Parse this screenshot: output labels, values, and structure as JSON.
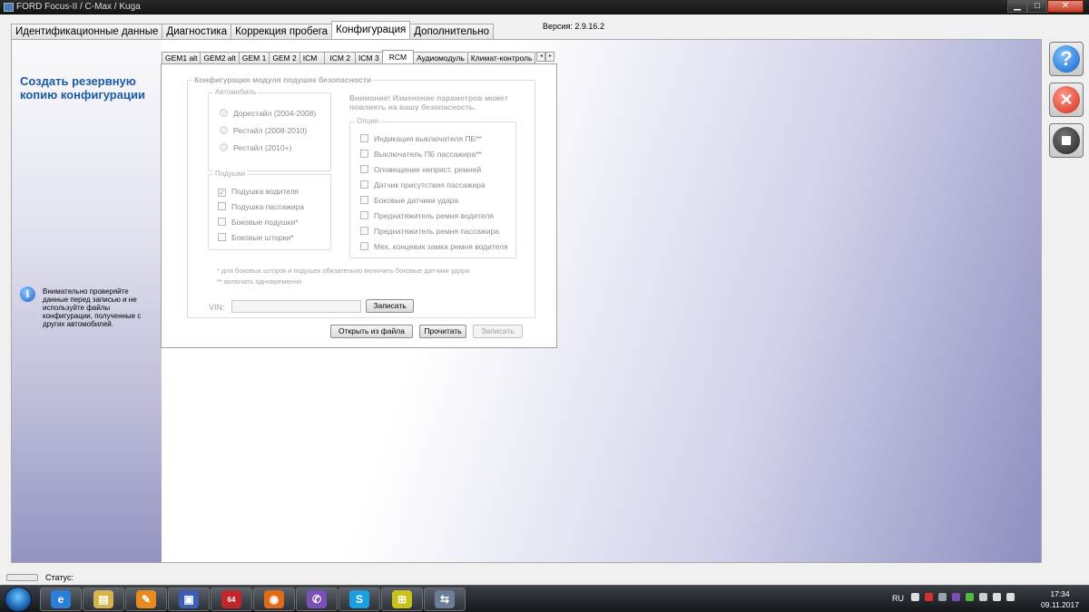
{
  "window": {
    "title": "FORD Focus-II / C-Max / Kuga",
    "min": "▁",
    "max": "□",
    "close": "✕"
  },
  "main_tabs": [
    {
      "label": "Идентификационные данные",
      "active": false
    },
    {
      "label": "Диагностика",
      "active": false
    },
    {
      "label": "Коррекция пробега",
      "active": false
    },
    {
      "label": "Конфигурация",
      "active": true
    },
    {
      "label": "Дополнительно",
      "active": false
    }
  ],
  "version": "Версия: 2.9.16.2",
  "left_panel": {
    "backup_link": "Создать резервную копию конфигурации",
    "info_icon": "i",
    "info_text": "Внимательно проверяйте данные перед записью и не используйте файлы конфигурации, полученные с других автомобилей."
  },
  "config_tabs": [
    {
      "label": "GEM1 alt",
      "active": false
    },
    {
      "label": "GEM2 alt",
      "active": false
    },
    {
      "label": "GEM 1",
      "active": false
    },
    {
      "label": "GEM 2",
      "active": false
    },
    {
      "label": "ICM",
      "active": false
    },
    {
      "label": "ICM 2",
      "active": false
    },
    {
      "label": "ICM 3",
      "active": false
    },
    {
      "label": "RCM",
      "active": true
    },
    {
      "label": "Аудиомодуль",
      "active": false
    },
    {
      "label": "Климат-контроль",
      "active": false
    }
  ],
  "tab_scroll": {
    "left": "◂",
    "right": "▸"
  },
  "rcm": {
    "group_title": "Конфигурация модуля подушек безопасности",
    "car_group": {
      "title": "Автомобиль",
      "options": [
        {
          "label": "Дорестайл (2004-2008)",
          "selected": false
        },
        {
          "label": "Рестайл (2008-2010)",
          "selected": false
        },
        {
          "label": "Рестайл (2010+)",
          "selected": false
        }
      ]
    },
    "airbags_group": {
      "title": "Подушки",
      "items": [
        {
          "label": "Подушка водителя",
          "checked": true,
          "mark": "✓"
        },
        {
          "label": "Подушка пассажира",
          "checked": false,
          "mark": ""
        },
        {
          "label": "Боковые подушки*",
          "checked": false,
          "mark": ""
        },
        {
          "label": "Боковые шторки*",
          "checked": false,
          "mark": ""
        }
      ]
    },
    "warning": "Внимание! Изменение параметров может повлиять на вашу безопасность.",
    "options_group": {
      "title": "Опции",
      "items": [
        {
          "label": "Индикация выключателя ПБ**",
          "checked": false
        },
        {
          "label": "Выключатель ПБ пассажира**",
          "checked": false
        },
        {
          "label": "Оповещение неприст. ремней",
          "checked": false
        },
        {
          "label": "Датчик присутствия пассажира",
          "checked": false
        },
        {
          "label": "Боковые датчики удара",
          "checked": false
        },
        {
          "label": "Преднатяжитель ремня водителя",
          "checked": false
        },
        {
          "label": "Преднатяжитель ремня пассажира",
          "checked": false
        },
        {
          "label": "Мех. концевик замка ремня водителя",
          "checked": false
        }
      ]
    },
    "footnote1": "* для боковых шторок и подушек обязательно включить боковые датчики удара",
    "footnote2": "** включать одновременно",
    "vin_label": "VIN:",
    "vin_value": "",
    "vin_write_button": "Записать"
  },
  "bottom_buttons": {
    "open_file": "Открыть из файла",
    "read": "Прочитать",
    "write": "Записать"
  },
  "right_buttons": {
    "help": "?",
    "close": "✕",
    "stop": ""
  },
  "status": {
    "label": "Статус:"
  },
  "taskbar": {
    "items": [
      {
        "name": "ie-icon",
        "glyph": "e",
        "color": "#2b7fd8"
      },
      {
        "name": "explorer-icon",
        "glyph": "▤",
        "color": "#d8b24a"
      },
      {
        "name": "notepad-icon",
        "glyph": "✎",
        "color": "#e88b1c"
      },
      {
        "name": "save-app-icon",
        "glyph": "▣",
        "color": "#3c5db5"
      },
      {
        "name": "app-64-icon",
        "glyph": "64",
        "color": "#c0262c"
      },
      {
        "name": "firefox-icon",
        "glyph": "◉",
        "color": "#e26a15"
      },
      {
        "name": "viber-icon",
        "glyph": "✆",
        "color": "#7a4fb7"
      },
      {
        "name": "skype-icon",
        "glyph": "S",
        "color": "#1aa0e0"
      },
      {
        "name": "chip-app-icon",
        "glyph": "⊞",
        "color": "#c9c21a"
      },
      {
        "name": "forscan-icon",
        "glyph": "⇆",
        "color": "#6b7d96"
      }
    ],
    "lang": "RU",
    "time": "17:34",
    "date": "09.11.2017"
  },
  "tray_icons": [
    {
      "name": "show-hidden-icon",
      "color": "#dddddd"
    },
    {
      "name": "red-app-tray-icon",
      "color": "#d6312f"
    },
    {
      "name": "tray-48-icon",
      "color": "#9aa3ad"
    },
    {
      "name": "viber-tray-icon",
      "color": "#7a4fb7"
    },
    {
      "name": "green-tray-icon",
      "color": "#4dbb44"
    },
    {
      "name": "flag-tray-icon",
      "color": "#cccccc"
    },
    {
      "name": "network-tray-icon",
      "color": "#dddddd"
    },
    {
      "name": "volume-tray-icon",
      "color": "#dddddd"
    }
  ]
}
